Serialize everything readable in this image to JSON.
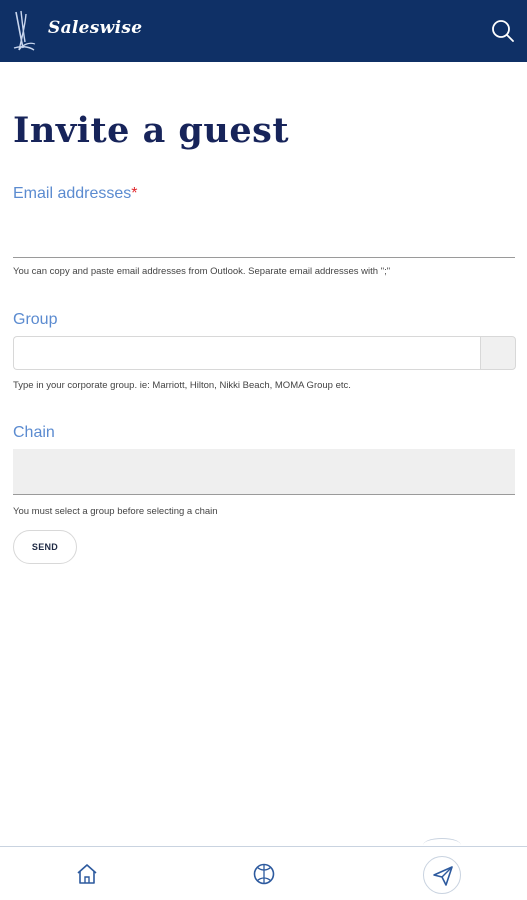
{
  "header": {
    "app_name": "Saleswise",
    "logo_icon": "saleswise-logo-icon",
    "search_icon": "search-icon"
  },
  "page": {
    "title": "Invite a guest"
  },
  "form": {
    "email": {
      "label": "Email addresses",
      "required_mark": "*",
      "value": "",
      "hint": "You can copy and paste email addresses from Outlook. Separate email addresses with \";\""
    },
    "group": {
      "label": "Group",
      "value": "",
      "hint": "Type in your corporate group. ie: Marriott, Hilton, Nikki Beach, MOMA Group etc."
    },
    "chain": {
      "label": "Chain",
      "value": "",
      "hint": "You must select a group before selecting a chain"
    },
    "send_label": "SEND"
  },
  "bottom_nav": {
    "items": [
      {
        "icon": "home-icon"
      },
      {
        "icon": "basketball-icon"
      },
      {
        "icon": "send-icon",
        "active": true
      }
    ]
  },
  "colors": {
    "header_bg": "#0f3066",
    "label_blue": "#5b8bd0",
    "title_navy": "#17245a",
    "required_red": "#e0262b",
    "nav_icon_blue": "#2d5a9e"
  }
}
